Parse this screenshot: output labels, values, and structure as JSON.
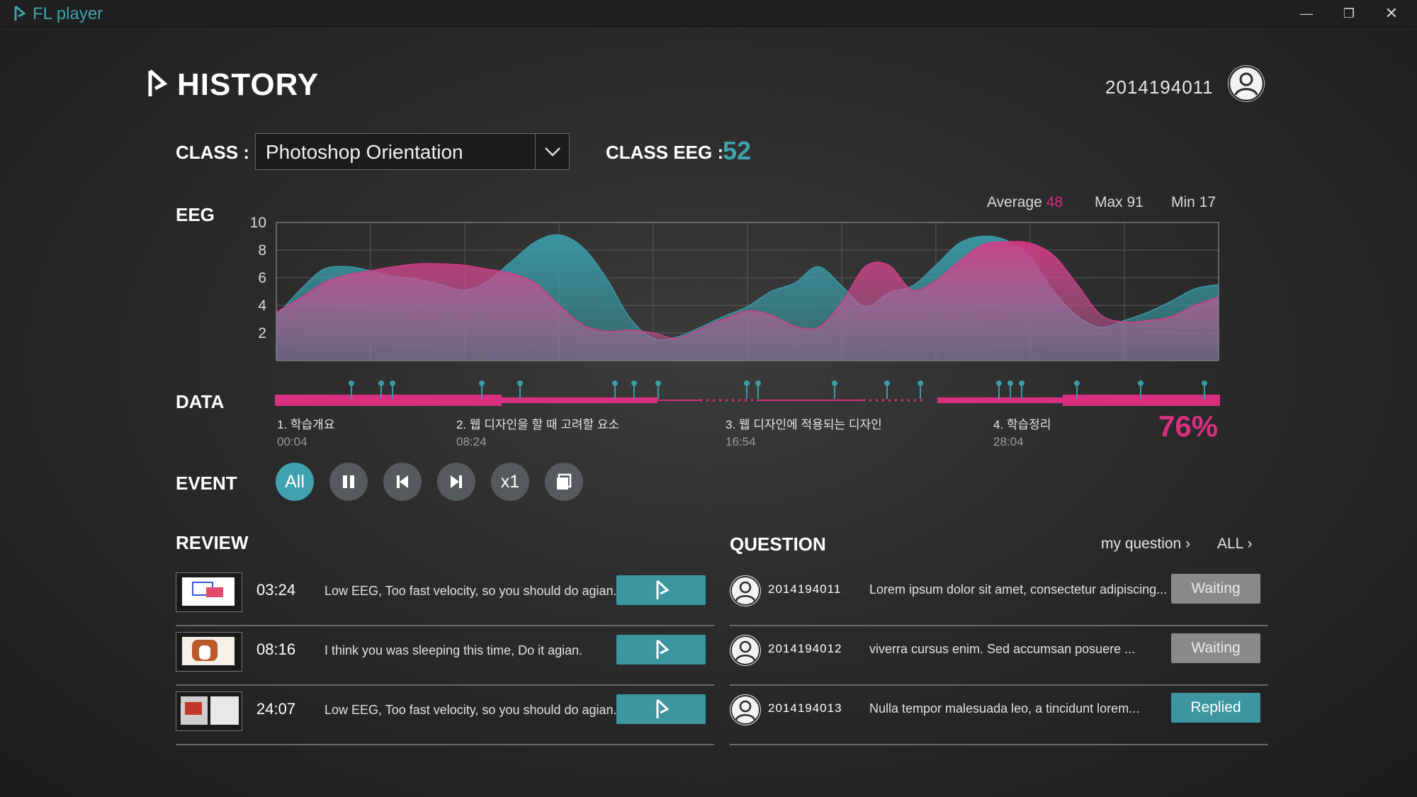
{
  "app": {
    "title": "FL player"
  },
  "window_controls": [
    "minimize",
    "restore",
    "close"
  ],
  "header": {
    "title": "HISTORY",
    "user_id": "2014194011"
  },
  "class_row": {
    "label": "CLASS :",
    "selected": "Photoshop Orientation",
    "eeg_label": "CLASS EEG :",
    "eeg_value": "52"
  },
  "eeg": {
    "label": "EEG",
    "average_label": "Average",
    "average_value": "48",
    "max": "Max 91",
    "min": "Min 17"
  },
  "chart_data": {
    "type": "area",
    "title": "",
    "xlabel": "",
    "ylabel": "",
    "ylim": [
      0,
      10
    ],
    "yticks": [
      10,
      8,
      6,
      4,
      2
    ],
    "grid": true,
    "x": [
      0,
      1,
      2,
      3,
      4,
      5,
      6,
      7,
      8,
      9,
      10,
      11,
      12,
      13,
      14,
      15,
      16,
      17,
      18,
      19,
      20,
      21,
      22,
      23,
      24,
      25,
      26,
      27,
      28,
      29,
      30,
      31,
      32,
      33,
      34,
      35,
      36,
      37,
      38,
      39,
      40
    ],
    "series": [
      {
        "color": "#3a9aa6",
        "values": [
          3.2,
          5.1,
          6.6,
          6.8,
          6.5,
          6.1,
          5.9,
          5.5,
          5.1,
          5.8,
          7.2,
          8.6,
          9.1,
          8.2,
          6.0,
          3.1,
          1.6,
          1.7,
          2.4,
          3.2,
          3.9,
          5.0,
          5.6,
          6.8,
          5.4,
          3.9,
          4.9,
          5.4,
          6.9,
          8.5,
          9.0,
          8.7,
          7.5,
          5.0,
          3.2,
          2.4,
          2.9,
          3.5,
          4.3,
          5.2,
          5.5
        ]
      },
      {
        "color": "#d33b86",
        "values": [
          3.5,
          4.5,
          5.6,
          6.2,
          6.5,
          6.8,
          7.0,
          7.0,
          6.9,
          6.6,
          6.3,
          5.6,
          4.0,
          2.6,
          2.1,
          2.2,
          2.0,
          1.6,
          2.3,
          3.0,
          3.6,
          3.3,
          2.5,
          2.4,
          4.2,
          6.8,
          6.9,
          5.1,
          5.8,
          7.2,
          8.4,
          8.6,
          8.5,
          7.6,
          5.5,
          3.3,
          2.8,
          2.9,
          3.2,
          4.0,
          4.6
        ]
      }
    ]
  },
  "data": {
    "label": "DATA",
    "progress": "76%",
    "chapters": [
      {
        "title": "1. 학습개요",
        "time": "00:04"
      },
      {
        "title": "2. 웹 디자인을 할 때 고려할 요소",
        "time": "08:24"
      },
      {
        "title": "3. 웹 디자인에 적용되는 디자인",
        "time": "16:54"
      },
      {
        "title": "4. 학습정리",
        "time": "28:04"
      }
    ]
  },
  "event": {
    "label": "EVENT",
    "buttons": [
      "All",
      "pause",
      "previous",
      "next",
      "x1",
      "copy"
    ],
    "all_label": "All",
    "speed_label": "x1"
  },
  "review": {
    "label": "REVIEW",
    "items": [
      {
        "time": "03:24",
        "text": "Low EEG, Too fast velocity, so you should do agian."
      },
      {
        "time": "08:16",
        "text": "I think you was sleeping this time, Do it agian."
      },
      {
        "time": "24:07",
        "text": "Low EEG, Too fast velocity, so you should do agian."
      }
    ]
  },
  "question": {
    "label": "QUESTION",
    "my_question": "my question",
    "all": "ALL",
    "items": [
      {
        "id": "2014194011",
        "text": "Lorem ipsum dolor sit amet, consectetur adipiscing...",
        "status": "Waiting"
      },
      {
        "id": "2014194012",
        "text": "viverra cursus enim. Sed accumsan posuere ...",
        "status": "Waiting"
      },
      {
        "id": "2014194013",
        "text": "Nulla tempor malesuada leo, a tincidunt lorem...",
        "status": "Replied"
      }
    ]
  },
  "colors": {
    "teal": "#3a9aa6",
    "pink": "#d33b86",
    "progress_pink": "#d6307f"
  }
}
